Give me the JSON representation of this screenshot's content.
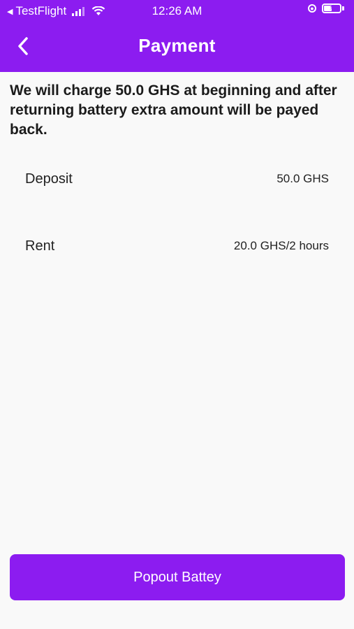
{
  "status_bar": {
    "back_app": "TestFlight",
    "time": "12:26 AM"
  },
  "header": {
    "title": "Payment",
    "background": "#8c1cf0"
  },
  "notice": "We will charge 50.0 GHS at beginning and after returning battery extra amount will be payed back.",
  "details": {
    "deposit_label": "Deposit",
    "deposit_value": "50.0 GHS",
    "rent_label": "Rent",
    "rent_value": "20.0 GHS/2 hours"
  },
  "action": {
    "label": "Popout Battey"
  }
}
